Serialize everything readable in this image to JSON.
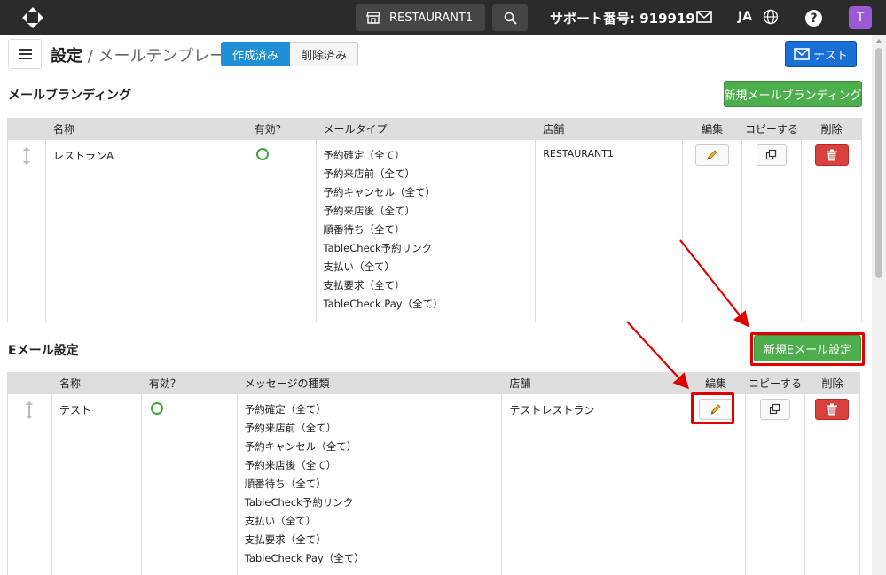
{
  "topbar": {
    "store_name": "RESTAURANT1",
    "support": "サポート番号: 919919",
    "lang": "JA",
    "help": "?",
    "avatar": "T"
  },
  "header": {
    "title_main": "設定",
    "title_sep": " / ",
    "title_sub": "メールテンプレート",
    "tab_created": "作成済み",
    "tab_deleted": "削除済み",
    "test_button": "テスト"
  },
  "branding": {
    "title": "メールブランディング",
    "new_button": "新規メールブランディング",
    "columns": [
      "名称",
      "有効?",
      "メールタイプ",
      "店舗",
      "編集",
      "コピーする",
      "削除"
    ],
    "rows": [
      {
        "name": "レストランA",
        "types": [
          "予約確定（全て）",
          "予約来店前（全て）",
          "予約キャンセル（全て）",
          "予約来店後（全て）",
          "順番待ち（全て）",
          "TableCheck予約リンク",
          "支払い（全て）",
          "支払要求（全て）",
          "TableCheck Pay（全て）"
        ],
        "store": "RESTAURANT1"
      }
    ]
  },
  "email_settings": {
    "title": "Eメール設定",
    "new_button": "新規Eメール設定",
    "columns": [
      "名称",
      "有効？",
      "メッセージの種類",
      "店舗",
      "編集",
      "コピーする",
      "削除"
    ],
    "rows": [
      {
        "name": "テスト",
        "types": [
          "予約確定（全て）",
          "予約来店前（全て）",
          "予約キャンセル（全て）",
          "予約来店後（全て）",
          "順番待ち（全て）",
          "TableCheck予約リンク",
          "支払い（全て）",
          "支払要求（全て）",
          "TableCheck Pay（全て）"
        ],
        "store": "テストレストラン"
      }
    ]
  },
  "colors": {
    "topbar": "#2b2b2b",
    "primary": "#1f8fd6",
    "success": "#4cae4c",
    "danger": "#d9413c",
    "annotation": "#e00000"
  }
}
